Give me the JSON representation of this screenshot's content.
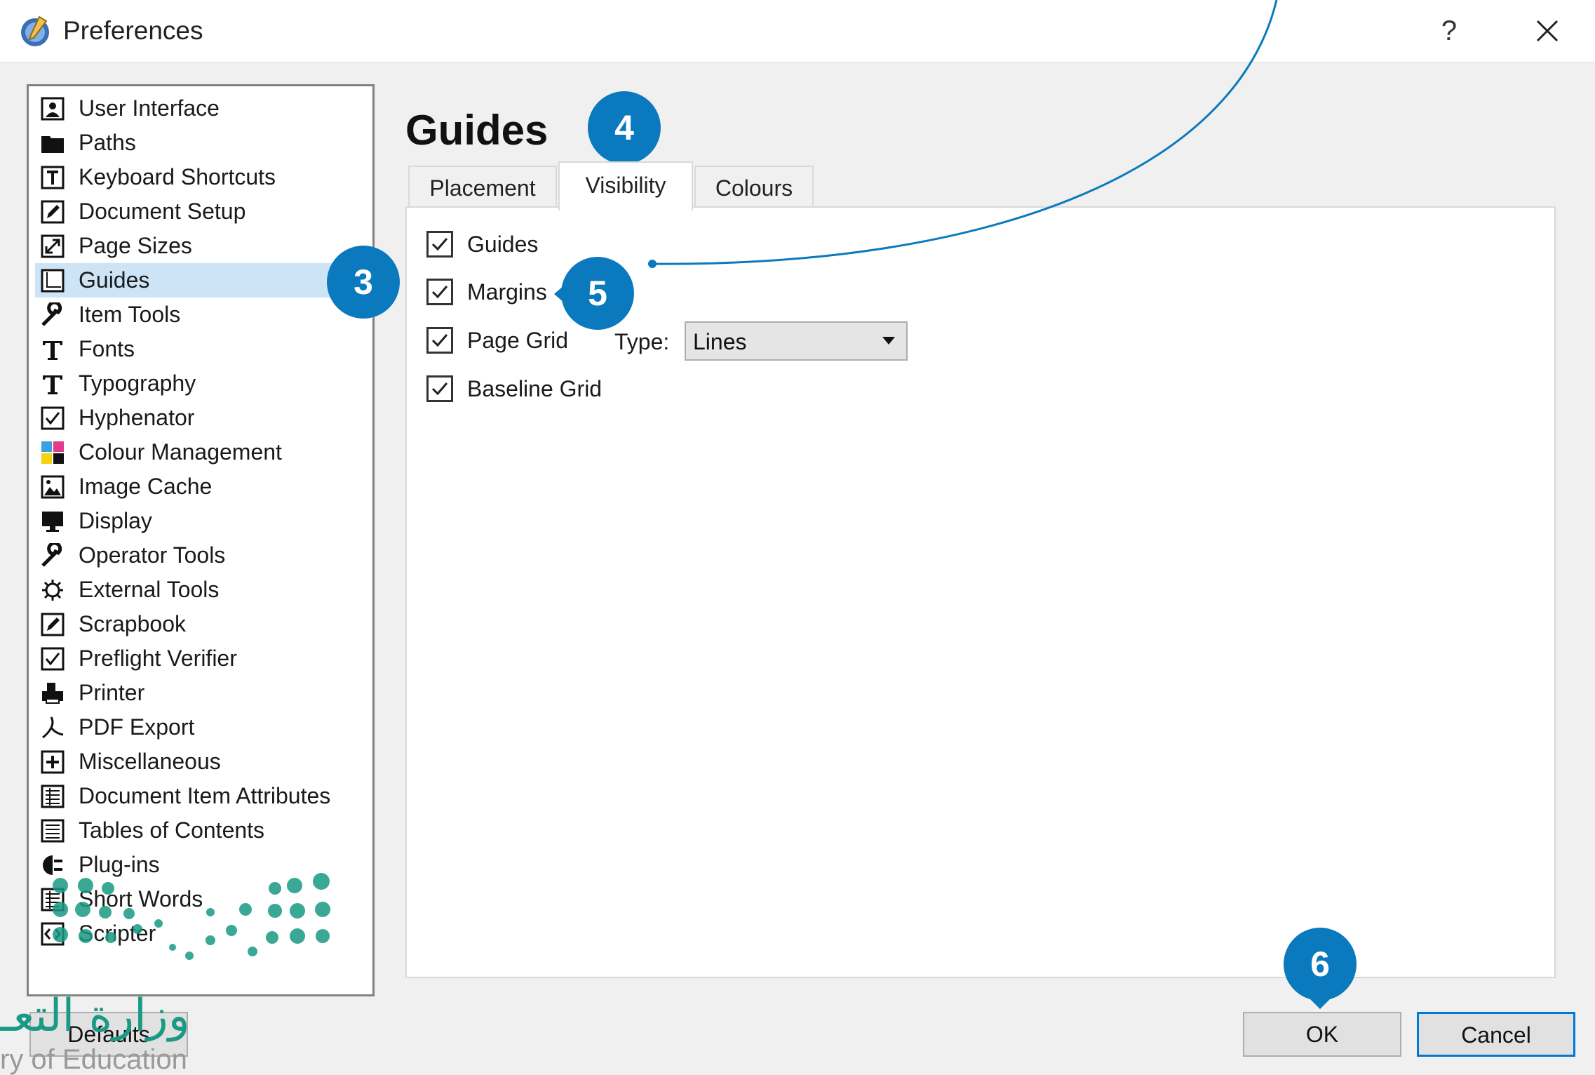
{
  "window": {
    "title": "Preferences",
    "help_label": "?",
    "close_icon": "close-icon",
    "app_icon": "scribus-icon"
  },
  "sidebar": {
    "selected": "Guides",
    "items": [
      {
        "label": "User Interface",
        "icon": "user-interface-icon"
      },
      {
        "label": "Paths",
        "icon": "folder-icon"
      },
      {
        "label": "Keyboard Shortcuts",
        "icon": "keyboard-shortcuts-icon"
      },
      {
        "label": "Document Setup",
        "icon": "document-setup-icon"
      },
      {
        "label": "Page Sizes",
        "icon": "page-sizes-icon"
      },
      {
        "label": "Guides",
        "icon": "guides-icon"
      },
      {
        "label": "Item Tools",
        "icon": "wrench-icon"
      },
      {
        "label": "Fonts",
        "icon": "font-icon"
      },
      {
        "label": "Typography",
        "icon": "font-icon"
      },
      {
        "label": "Hyphenator",
        "icon": "checkbox-icon"
      },
      {
        "label": "Colour Management",
        "icon": "colour-management-icon"
      },
      {
        "label": "Image Cache",
        "icon": "image-icon"
      },
      {
        "label": "Display",
        "icon": "monitor-icon"
      },
      {
        "label": "Operator Tools",
        "icon": "wrench-icon"
      },
      {
        "label": "External Tools",
        "icon": "gear-icon"
      },
      {
        "label": "Scrapbook",
        "icon": "scrapbook-icon"
      },
      {
        "label": "Preflight Verifier",
        "icon": "checkbox-icon"
      },
      {
        "label": "Printer",
        "icon": "printer-icon"
      },
      {
        "label": "PDF Export",
        "icon": "pdf-icon"
      },
      {
        "label": "Miscellaneous",
        "icon": "plus-box-icon"
      },
      {
        "label": "Document Item Attributes",
        "icon": "list-icon"
      },
      {
        "label": "Tables of Contents",
        "icon": "list-icon"
      },
      {
        "label": "Plug-ins",
        "icon": "plugin-icon"
      },
      {
        "label": "Short Words",
        "icon": "list-icon"
      },
      {
        "label": "Scripter",
        "icon": "scripter-icon"
      }
    ]
  },
  "content": {
    "title": "Guides",
    "tabs": [
      {
        "label": "Placement",
        "active": false
      },
      {
        "label": "Visibility",
        "active": true
      },
      {
        "label": "Colours",
        "active": false
      }
    ],
    "options": [
      {
        "label": "Guides",
        "checked": true
      },
      {
        "label": "Margins",
        "checked": true
      },
      {
        "label": "Page Grid",
        "checked": true
      },
      {
        "label": "Baseline Grid",
        "checked": true
      }
    ],
    "type_label": "Type:",
    "type_value": "Lines"
  },
  "buttons": {
    "defaults": "Defaults",
    "ok": "OK",
    "cancel": "Cancel"
  },
  "callouts": [
    "3",
    "4",
    "5",
    "6"
  ],
  "watermark": {
    "arabic": "وزارة التعـ",
    "latin": "ry of Education"
  },
  "colors": {
    "callout": "#0b79bd",
    "selection": "#cde4f7",
    "watermark": "#1a9a84"
  }
}
